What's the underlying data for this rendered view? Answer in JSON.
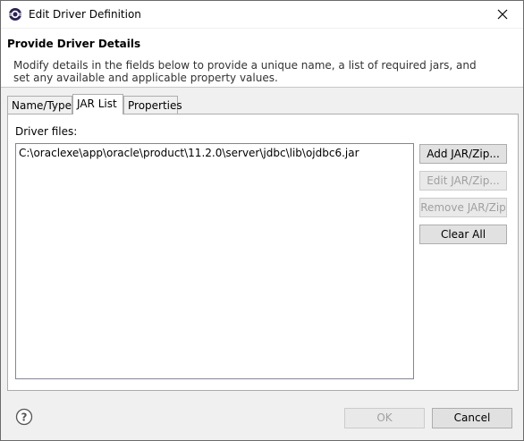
{
  "window": {
    "title": "Edit Driver Definition"
  },
  "header": {
    "title": "Provide Driver Details",
    "description": "Modify details in the fields below to provide a unique name, a list of required jars, and set any available and applicable property values."
  },
  "tabs": [
    {
      "label": "Name/Type",
      "active": false
    },
    {
      "label": "JAR List",
      "active": true
    },
    {
      "label": "Properties",
      "active": false
    }
  ],
  "jar_list": {
    "label": "Driver files:",
    "files": [
      "C:\\oraclexe\\app\\oracle\\product\\11.2.0\\server\\jdbc\\lib\\ojdbc6.jar"
    ],
    "buttons": {
      "add": {
        "label": "Add JAR/Zip...",
        "enabled": true
      },
      "edit": {
        "label": "Edit JAR/Zip...",
        "enabled": false
      },
      "remove": {
        "label": "Remove JAR/Zip",
        "enabled": false
      },
      "clear": {
        "label": "Clear All",
        "enabled": true
      }
    }
  },
  "footer": {
    "ok_label": "OK",
    "ok_enabled": false,
    "cancel_label": "Cancel"
  },
  "icons": {
    "app": "eclipse-icon",
    "close": "close-icon",
    "help": "help-icon"
  }
}
